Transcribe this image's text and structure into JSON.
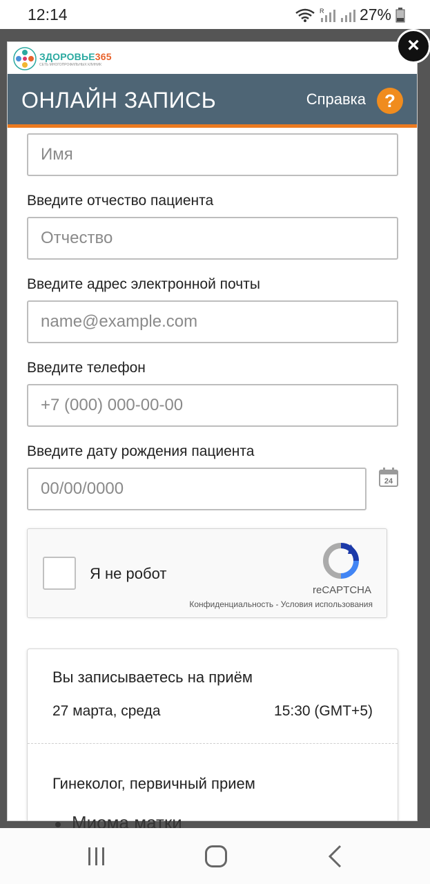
{
  "status_bar": {
    "time": "12:14",
    "battery_percent": "27%",
    "roaming_indicator": "R"
  },
  "modal": {
    "logo": {
      "name": "ЗДОРОВЬЕ",
      "number": "365",
      "subtitle": "СЕТЬ МНОГОПРОФИЛЬНЫХ КЛИНИК"
    },
    "header": {
      "title": "ОНЛАЙН ЗАПИСЬ",
      "help_label": "Справка",
      "help_icon": "?"
    },
    "close_icon": "×",
    "form": {
      "first_name": {
        "placeholder": "Имя"
      },
      "patronymic": {
        "label": "Введите отчество пациента",
        "placeholder": "Отчество"
      },
      "email": {
        "label": "Введите адрес электронной почты",
        "placeholder": "name@example.com"
      },
      "phone": {
        "label": "Введите телефон",
        "placeholder": "+7 (000) 000-00-00"
      },
      "birth_date": {
        "label": "Введите дату рождения пациента",
        "placeholder": "00/00/0000",
        "calendar_icon_day": "24"
      }
    },
    "recaptcha": {
      "label": "Я не робот",
      "brand": "reCAPTCHA",
      "privacy_link": "Конфиденциальность",
      "separator": " - ",
      "terms_link": "Условия использования"
    },
    "summary": {
      "title": "Вы записываетесь на приём",
      "date": "27 марта, среда",
      "time": "15:30 (GMT+5)",
      "service": "Гинеколог, первичный прием"
    }
  },
  "background_text": "Миома матки",
  "colors": {
    "header_bg": "#4e6575",
    "accent": "#ec7a20",
    "help_icon": "#f08c1e",
    "logo_teal": "#2aa9a0"
  }
}
